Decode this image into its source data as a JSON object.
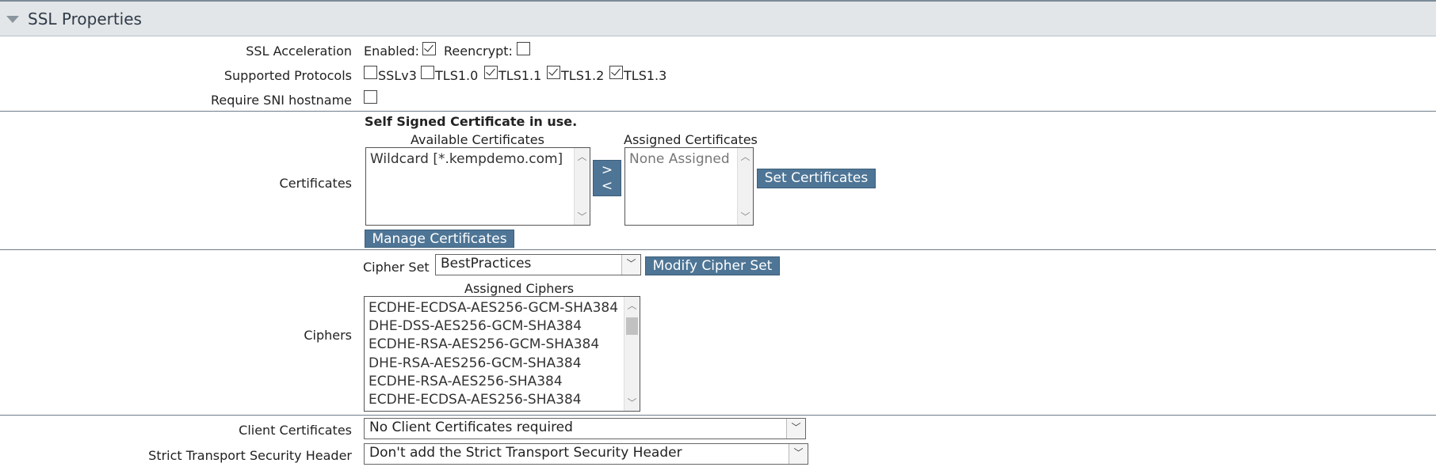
{
  "section": {
    "title": "SSL Properties"
  },
  "ssl_acceleration": {
    "label": "SSL Acceleration",
    "enabled_label": "Enabled:",
    "enabled": true,
    "reencrypt_label": "Reencrypt:",
    "reencrypt": false
  },
  "protocols": {
    "label": "Supported Protocols",
    "items": [
      {
        "name": "SSLv3",
        "checked": false
      },
      {
        "name": "TLS1.0",
        "checked": false
      },
      {
        "name": "TLS1.1",
        "checked": true
      },
      {
        "name": "TLS1.2",
        "checked": true
      },
      {
        "name": "TLS1.3",
        "checked": true
      }
    ]
  },
  "sni": {
    "label": "Require SNI hostname",
    "checked": false
  },
  "certificates": {
    "label": "Certificates",
    "notice": "Self Signed Certificate in use.",
    "available_label": "Available Certificates",
    "available": [
      "Wildcard [*.kempdemo.com]"
    ],
    "assigned_label": "Assigned Certificates",
    "assigned": [
      "None Assigned"
    ],
    "move_right": ">",
    "move_left": "<",
    "set_button": "Set Certificates",
    "manage_button": "Manage Certificates"
  },
  "ciphers": {
    "label": "Ciphers",
    "cipher_set_label": "Cipher Set",
    "cipher_set_value": "BestPractices",
    "modify_button": "Modify Cipher Set",
    "assigned_label": "Assigned Ciphers",
    "assigned": [
      "ECDHE-ECDSA-AES256-GCM-SHA384",
      "DHE-DSS-AES256-GCM-SHA384",
      "ECDHE-RSA-AES256-GCM-SHA384",
      "DHE-RSA-AES256-GCM-SHA384",
      "ECDHE-RSA-AES256-SHA384",
      "ECDHE-ECDSA-AES256-SHA384"
    ]
  },
  "client_certificates": {
    "label": "Client Certificates",
    "value": "No Client Certificates required"
  },
  "hsts": {
    "label": "Strict Transport Security Header",
    "value": "Don't add the Strict Transport Security Header"
  },
  "icons": {
    "collapse": "triangle-down-icon",
    "scroll_up": "chevron-up-icon",
    "scroll_down": "chevron-down-icon",
    "dropdown": "chevron-down-icon",
    "checkmark": "check-icon"
  },
  "colors": {
    "header_bg": "#e3e6e8",
    "button_bg": "#4e7595",
    "divider": "#6f7d89"
  }
}
